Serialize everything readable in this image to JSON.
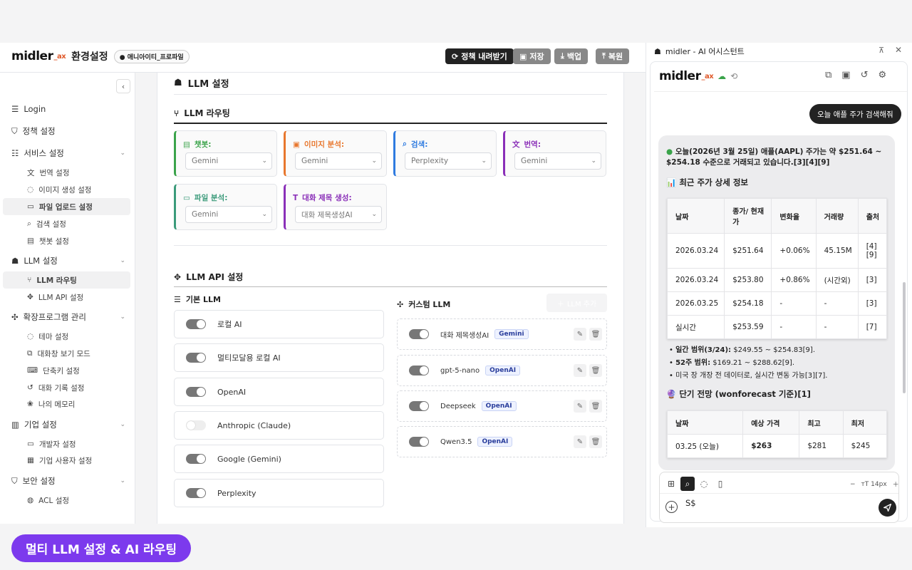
{
  "header": {
    "app_name": "midler",
    "app_suffix": "_ax",
    "title": "환경설정",
    "profile_badge": "애니아이티_프로파일",
    "buttons": {
      "policy": "정책 내려받기",
      "save": "저장",
      "backup": "백업",
      "restore": "복원"
    }
  },
  "sidebar": {
    "login": "Login",
    "policy": "정책 설정",
    "service": "서비스 설정",
    "service_items": [
      "번역 설정",
      "이미지 생성 설정",
      "파일 업로드 설정",
      "검색 설정",
      "챗봇 설정"
    ],
    "llm": "LLM 설정",
    "llm_items": [
      "LLM 라우팅",
      "LLM API 설정"
    ],
    "ext": "확장프로그램 관리",
    "ext_items": [
      "테마 설정",
      "대화창 보기 모드",
      "단축키 설정",
      "대화 기록 설정",
      "나의 메모리"
    ],
    "corp": "기업 설정",
    "corp_items": [
      "개발자 설정",
      "기업 사용자 설정"
    ],
    "security": "보안 설정",
    "security_items": [
      "ACL 설정"
    ]
  },
  "main": {
    "section_title": "LLM 설정",
    "routing_title": "LLM 라우팅",
    "routing_cards": [
      {
        "label": "챗봇:",
        "value": "Gemini",
        "color": "#3aa34a"
      },
      {
        "label": "이미지 분석:",
        "value": "Gemini",
        "color": "#e8772e"
      },
      {
        "label": "검색:",
        "value": "Perplexity",
        "color": "#2f7be0"
      },
      {
        "label": "번역:",
        "value": "Gemini",
        "color": "#8a2fb8"
      },
      {
        "label": "파일 분석:",
        "value": "Gemini",
        "color": "#3a9a7a"
      },
      {
        "label": "대화 제목 생성:",
        "value": "대화 제목생성AI",
        "color": "#8a2fb8"
      }
    ],
    "api_title": "LLM API 설정",
    "basic_title": "기본 LLM",
    "custom_title": "커스텀 LLM",
    "add_button": "LLM 추가",
    "basic_llms": [
      {
        "name": "로컬 AI",
        "on": true
      },
      {
        "name": "멀티모달용 로컬 AI",
        "on": true
      },
      {
        "name": "OpenAI",
        "on": true
      },
      {
        "name": "Anthropic (Claude)",
        "on": false
      },
      {
        "name": "Google (Gemini)",
        "on": true
      },
      {
        "name": "Perplexity",
        "on": true
      }
    ],
    "custom_llms": [
      {
        "name": "대화 제목생성AI",
        "provider": "Gemini"
      },
      {
        "name": "gpt-5-nano",
        "provider": "OpenAI"
      },
      {
        "name": "Deepseek",
        "provider": "OpenAI"
      },
      {
        "name": "Qwen3.5",
        "provider": "OpenAI"
      }
    ]
  },
  "assistant": {
    "window_title": "midler - AI 어시스턴트",
    "user_message": "오늘 애플 주가 검색해줘",
    "answer_intro": "오늘(2026년 3월 25일) 애플(AAPL) 주가는 약 $251.64 ~ $254.18 수준으로 거래되고 있습니다.[3][4][9]",
    "detail_heading": "📊 최근 주가 상세 정보",
    "table_headers": [
      "날짜",
      "종가/ 현재가",
      "변화율",
      "거래량",
      "출처"
    ],
    "table_rows": [
      [
        "2026.03.24",
        "$251.64",
        "+0.06%",
        "45.15M",
        "[4] [9]"
      ],
      [
        "2026.03.24",
        "$253.80",
        "+0.86%",
        "(시간외)",
        "[3]"
      ],
      [
        "2026.03.25",
        "$254.18",
        "-",
        "-",
        "[3]"
      ],
      [
        "실시간",
        "$253.59",
        "-",
        "-",
        "[7]"
      ]
    ],
    "bullets": [
      {
        "bold": "일간 범위(3/24):",
        "text": " $249.55 ~ $254.83[9]."
      },
      {
        "bold": "52주 범위:",
        "text": " $169.21 ~ $288.62[9]."
      },
      {
        "bold": "",
        "text": "미국 장 개장 전 데이터로, 실시간 변동 가능[3][7]."
      }
    ],
    "forecast_heading": "🔮 단기 전망 (wonforecast 기준)[1]",
    "forecast_headers": [
      "날짜",
      "예상 가격",
      "최고",
      "최저"
    ],
    "forecast_rows": [
      [
        "03.25 (오늘)",
        "$263",
        "$281",
        "$245"
      ]
    ],
    "input_value": "S$",
    "font_size": "14px"
  },
  "promo_badge": "멀티 LLM 설정 & AI 라우팅"
}
